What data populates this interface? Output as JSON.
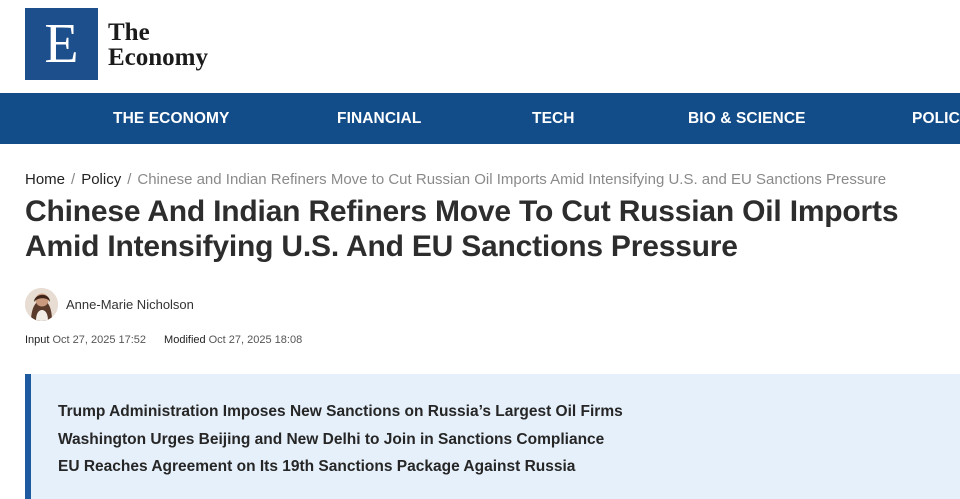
{
  "logo": {
    "mark": "E",
    "line1": "The",
    "line2": "Economy"
  },
  "nav": {
    "items": [
      {
        "label": "THE ECONOMY"
      },
      {
        "label": "FINANCIAL"
      },
      {
        "label": "TECH"
      },
      {
        "label": "BIO & SCIENCE"
      },
      {
        "label": "POLICY"
      }
    ]
  },
  "breadcrumb": {
    "home": "Home",
    "section": "Policy",
    "separator": "/",
    "current": "Chinese and Indian Refiners Move to Cut Russian Oil Imports Amid Intensifying U.S. and EU Sanctions Pressure"
  },
  "article": {
    "title": "Chinese And Indian Refiners Move To Cut Russian Oil Imports Amid Intensifying U.S. And EU Sanctions Pressure",
    "author": "Anne-Marie Nicholson",
    "input_label": "Input",
    "input_date": "Oct 27, 2025 17:52",
    "modified_label": "Modified",
    "modified_date": "Oct 27, 2025 18:08"
  },
  "summary": {
    "items": [
      "Trump Administration Imposes New Sanctions on Russia’s Largest Oil Firms",
      "Washington Urges Beijing and New Delhi to Join in Sanctions Compliance",
      "EU Reaches Agreement on Its 19th Sanctions Package Against Russia"
    ]
  },
  "colors": {
    "brand_blue": "#124d89",
    "logo_blue": "#1d4f8c",
    "summary_bg": "#e6f0fa",
    "summary_border": "#1d5aa0"
  }
}
